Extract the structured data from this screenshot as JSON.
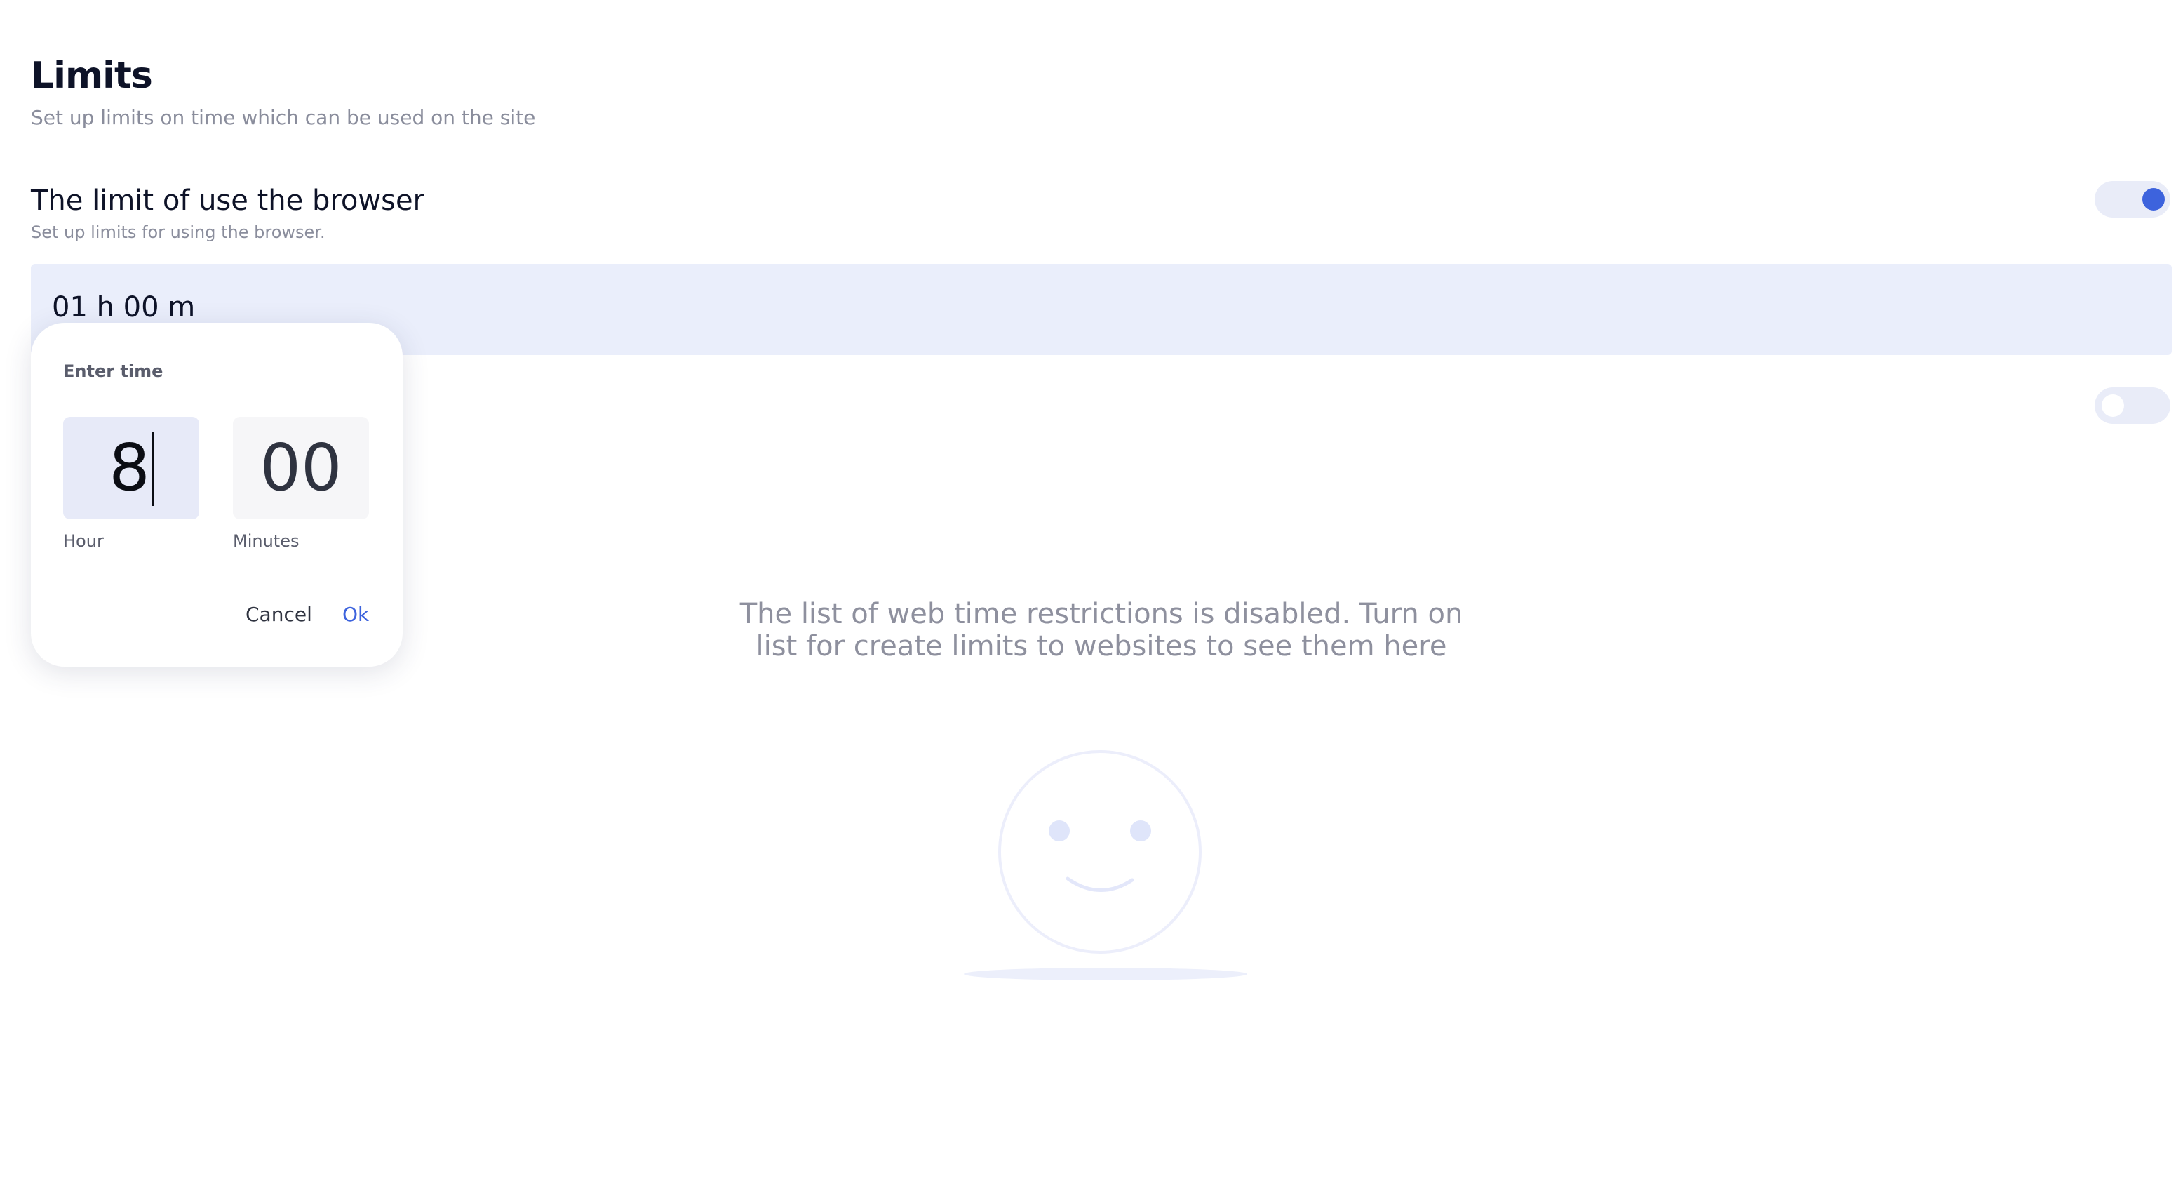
{
  "header": {
    "title": "Limits",
    "subtitle": "Set up limits on time which can be used on the site"
  },
  "browser_limit": {
    "title": "The limit of use the browser",
    "subtitle": "Set up limits for using the browser.",
    "enabled": true,
    "value": "01 h 00 m"
  },
  "web_limits": {
    "enabled": false,
    "empty_message_line1": "The list of web time restrictions is disabled. Turn on",
    "empty_message_line2": "list for create limits to websites to see them here",
    "illustration": "smiley-face-icon"
  },
  "time_picker": {
    "title": "Enter time",
    "hour_value": "8",
    "minutes_value": "00",
    "hour_label": "Hour",
    "minutes_label": "Minutes",
    "cancel_label": "Cancel",
    "ok_label": "Ok"
  },
  "colors": {
    "accent": "#3d63dd",
    "toggle_track": "#e9ecf8",
    "time_bar": "#eaeefb",
    "muted_text": "#8a8d9c"
  }
}
